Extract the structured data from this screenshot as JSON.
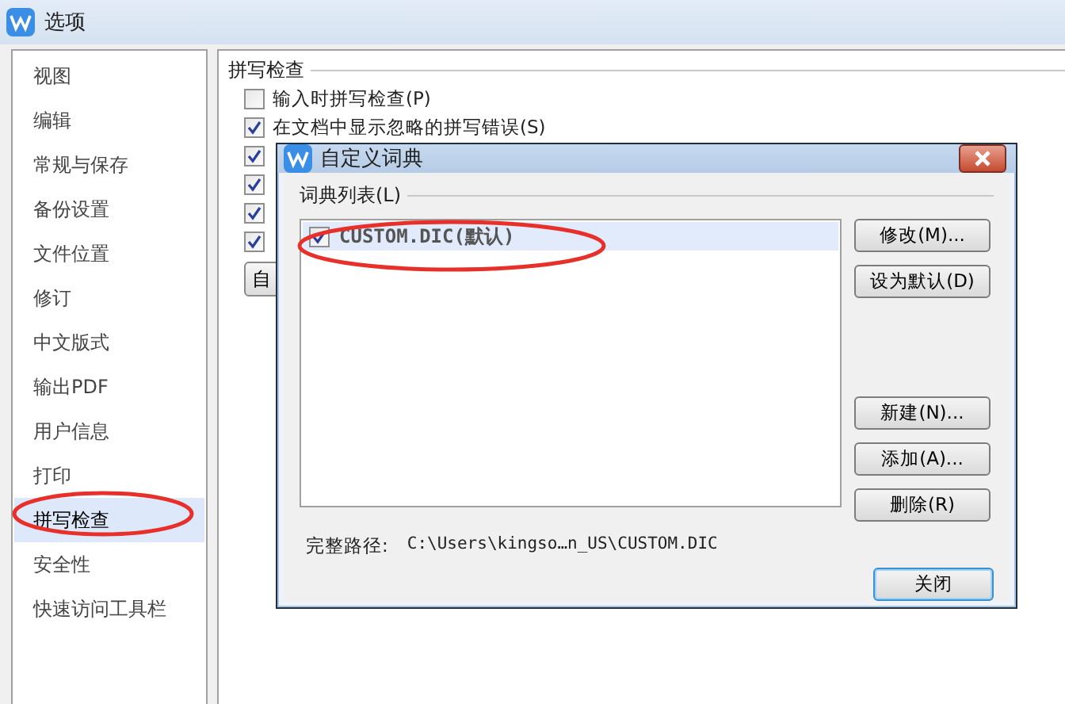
{
  "window": {
    "title": "选项"
  },
  "sidebar": {
    "items": [
      {
        "label": "视图",
        "selected": false
      },
      {
        "label": "编辑",
        "selected": false
      },
      {
        "label": "常规与保存",
        "selected": false
      },
      {
        "label": "备份设置",
        "selected": false
      },
      {
        "label": "文件位置",
        "selected": false
      },
      {
        "label": "修订",
        "selected": false
      },
      {
        "label": "中文版式",
        "selected": false
      },
      {
        "label": "输出PDF",
        "selected": false
      },
      {
        "label": "用户信息",
        "selected": false
      },
      {
        "label": "打印",
        "selected": false
      },
      {
        "label": "拼写检查",
        "selected": true
      },
      {
        "label": "安全性",
        "selected": false
      },
      {
        "label": "快速访问工具栏",
        "selected": false
      }
    ]
  },
  "section": {
    "title": "拼写检查",
    "options": [
      {
        "label": "输入时拼写检查(P)",
        "checked": false
      },
      {
        "label": "在文档中显示忽略的拼写错误(S)",
        "checked": true
      },
      {
        "checked": true
      },
      {
        "checked": true
      },
      {
        "checked": true
      },
      {
        "checked": true
      }
    ],
    "button": "自"
  },
  "dialog": {
    "title": "自定义词典",
    "list_label": "词典列表(L)",
    "dictionaries": [
      {
        "label": "CUSTOM.DIC(默认)",
        "checked": true,
        "selected": true
      }
    ],
    "buttons_top": [
      "修改(M)...",
      "设为默认(D)"
    ],
    "buttons_bottom": [
      "新建(N)...",
      "添加(A)...",
      "删除(R)"
    ],
    "path_label": "完整路径:",
    "path": "C:\\Users\\kingso…n_US\\CUSTOM.DIC",
    "close_button": "关闭"
  }
}
